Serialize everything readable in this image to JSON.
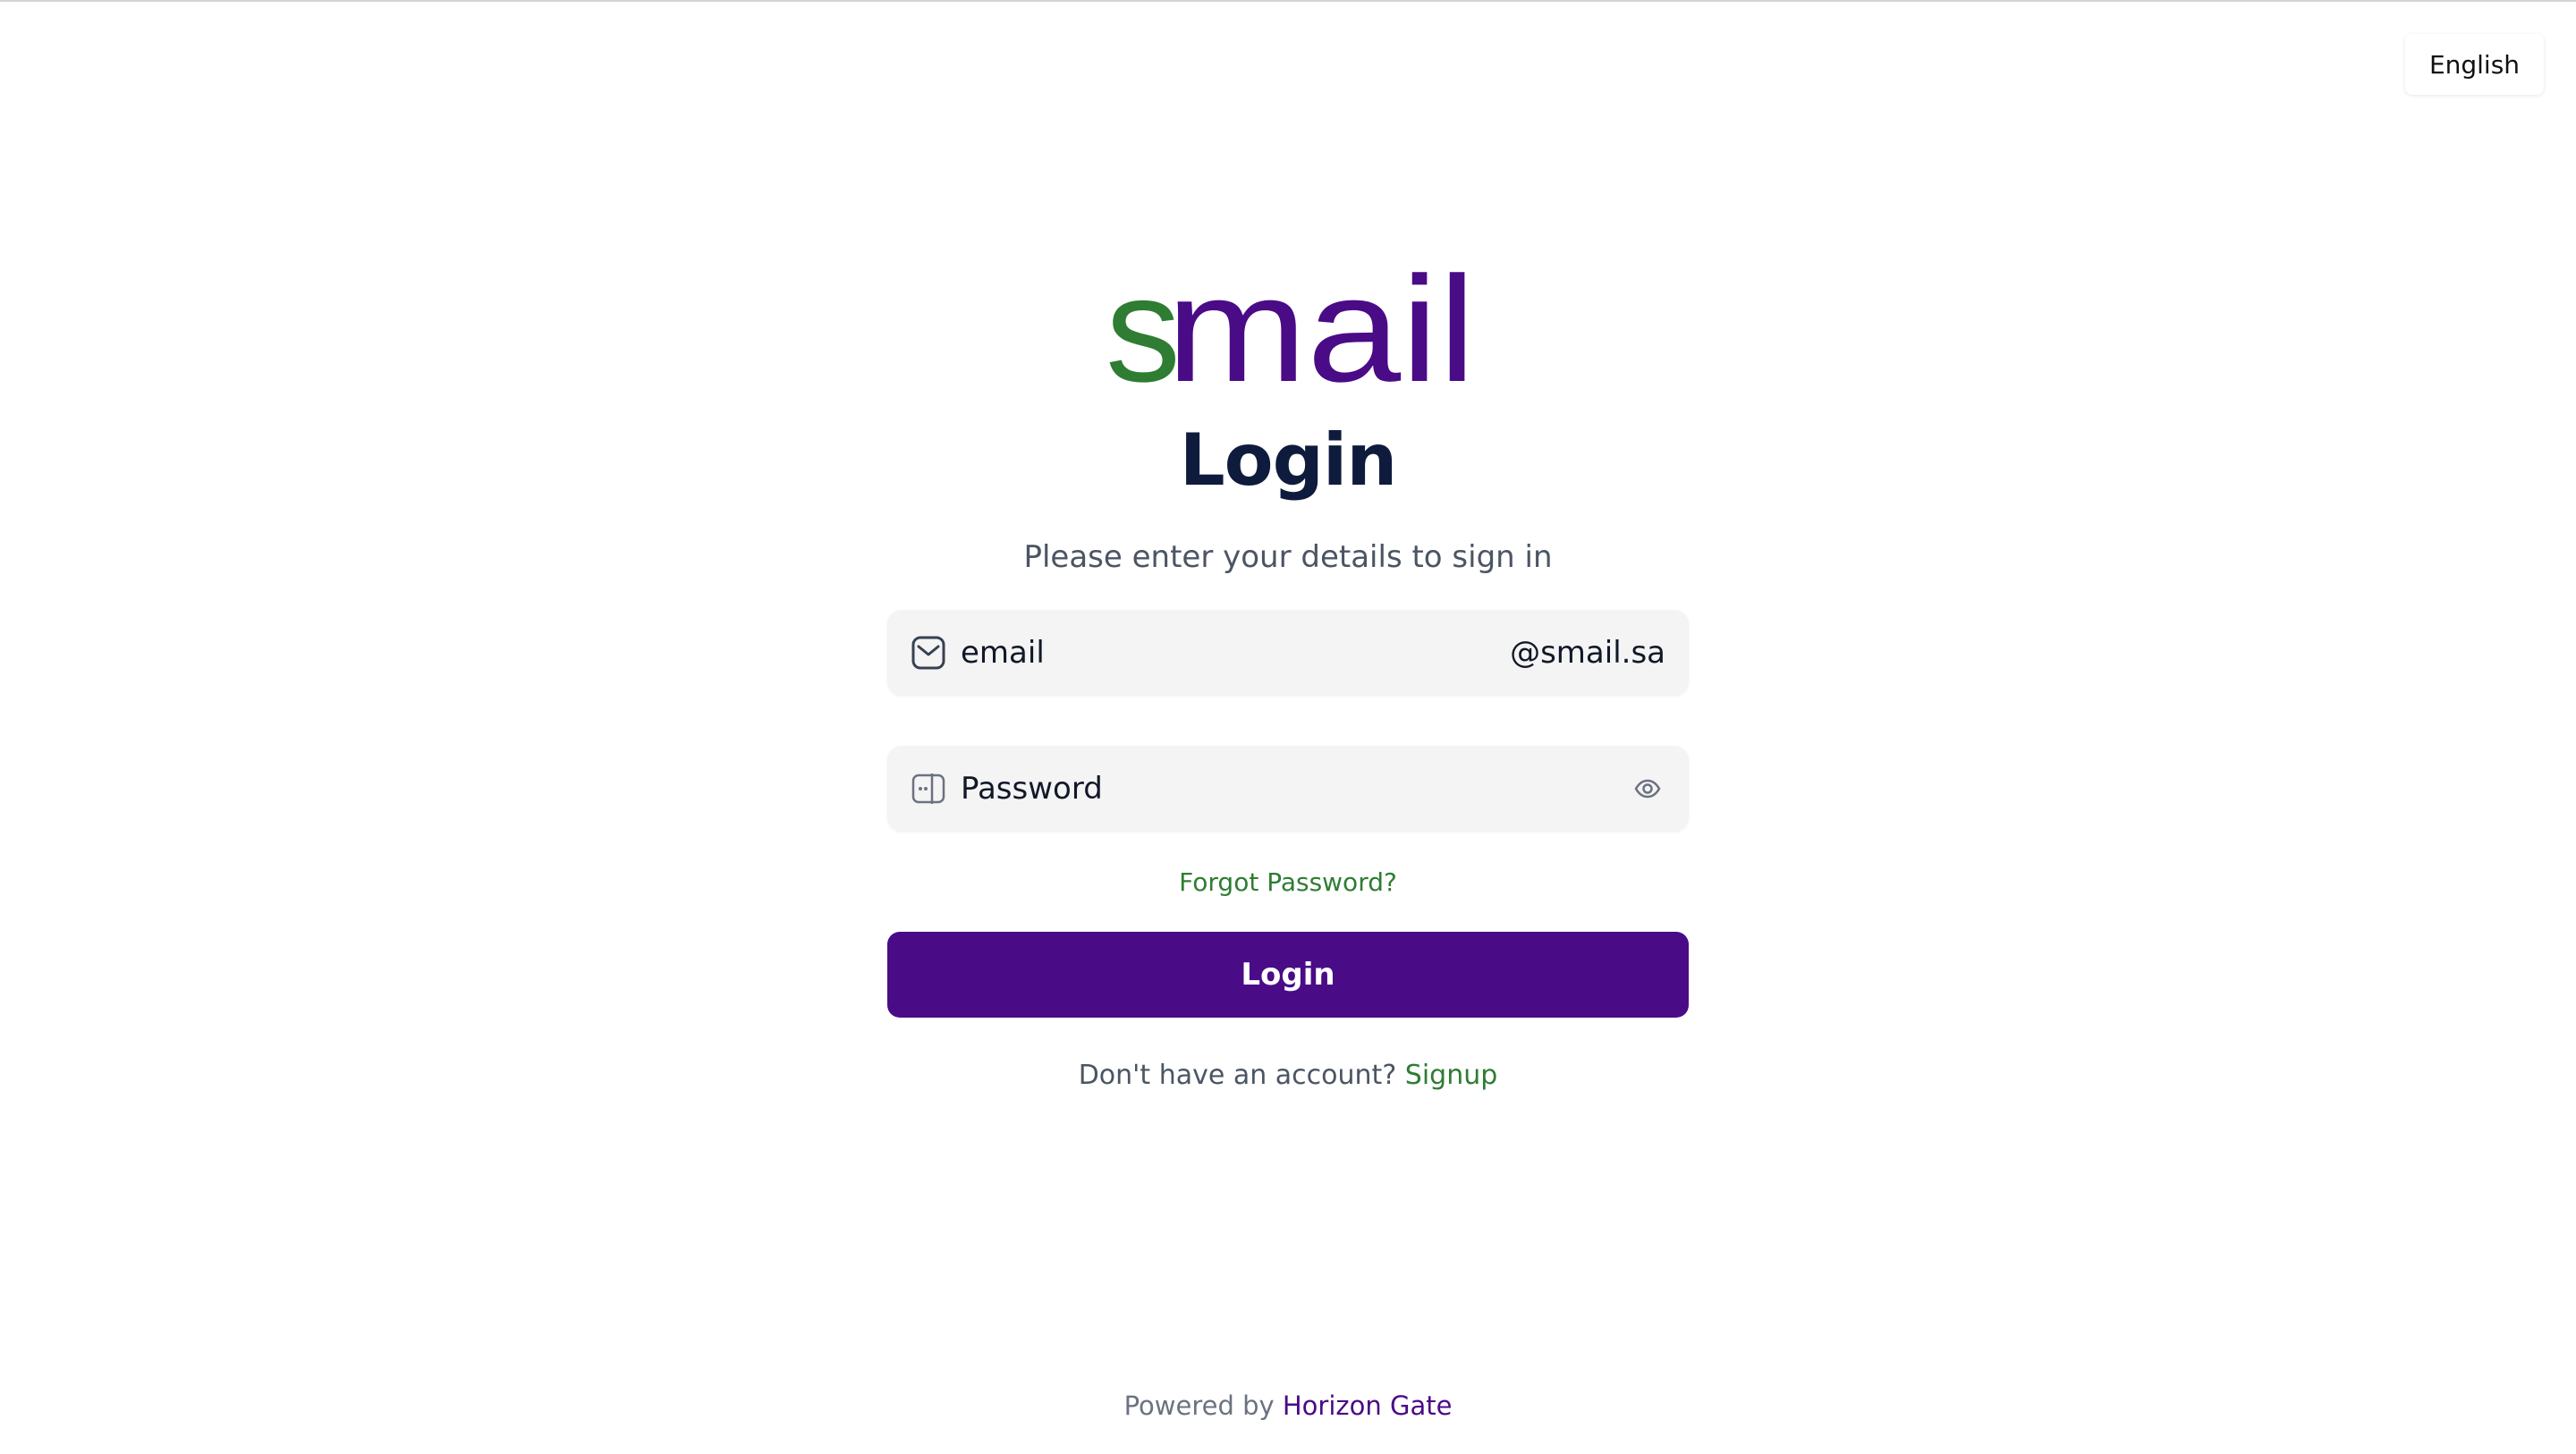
{
  "header": {
    "language_label": "English"
  },
  "logo": {
    "text_s": "s",
    "text_rest": "mail",
    "color_s": "#2e7d32",
    "color_rest": "#4a0b87"
  },
  "login_form": {
    "title": "Login",
    "subtitle": "Please enter your details to sign in",
    "email": {
      "placeholder": "email",
      "value": "",
      "suffix": "@smail.sa",
      "icon": "mail-icon"
    },
    "password": {
      "placeholder": "Password",
      "value": "",
      "icon": "password-icon",
      "toggle_icon": "eye-icon"
    },
    "forgot_password_label": "Forgot Password?",
    "submit_label": "Login",
    "signup_prompt": "Don't have an account?",
    "signup_link": "Signup"
  },
  "footer": {
    "powered_by_label": "Powered by",
    "brand_name": "Horizon Gate"
  },
  "colors": {
    "accent": "#4a0b87",
    "link_green": "#2e7d32",
    "title": "#0f1b3d",
    "field_bg": "#f4f4f5"
  }
}
